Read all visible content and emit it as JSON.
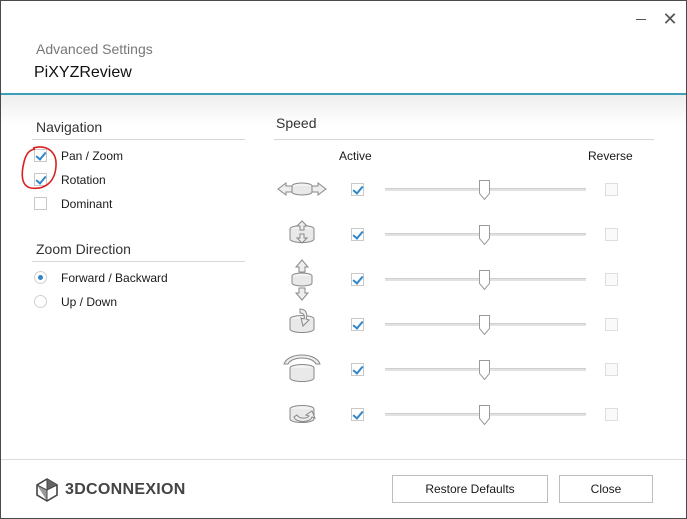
{
  "window": {
    "subtitle": "Advanced Settings",
    "title": "PiXYZReview",
    "accent_color": "#3d9fb7",
    "minimize_icon": "minimize-icon",
    "close_icon": "close-icon"
  },
  "navigation": {
    "heading": "Navigation",
    "options": [
      {
        "label": "Pan / Zoom",
        "checked": true
      },
      {
        "label": "Rotation",
        "checked": true
      },
      {
        "label": "Dominant",
        "checked": false
      }
    ]
  },
  "zoom_direction": {
    "heading": "Zoom Direction",
    "options": [
      {
        "label": "Forward / Backward",
        "selected": true
      },
      {
        "label": "Up / Down",
        "selected": false
      }
    ]
  },
  "speed": {
    "heading": "Speed",
    "active_header": "Active",
    "reverse_header": "Reverse",
    "rows": [
      {
        "icon": "pan-left-right-icon",
        "active": true,
        "reverse": false,
        "level": 0.5
      },
      {
        "icon": "zoom-in-out-icon",
        "active": true,
        "reverse": false,
        "level": 0.5
      },
      {
        "icon": "pan-up-down-icon",
        "active": true,
        "reverse": false,
        "level": 0.5
      },
      {
        "icon": "tilt-icon",
        "active": true,
        "reverse": false,
        "level": 0.5
      },
      {
        "icon": "roll-icon",
        "active": true,
        "reverse": false,
        "level": 0.5
      },
      {
        "icon": "spin-icon",
        "active": true,
        "reverse": false,
        "level": 0.5
      }
    ]
  },
  "footer": {
    "logo_text": "3DCONNEXION",
    "restore_label": "Restore Defaults",
    "close_label": "Close"
  }
}
